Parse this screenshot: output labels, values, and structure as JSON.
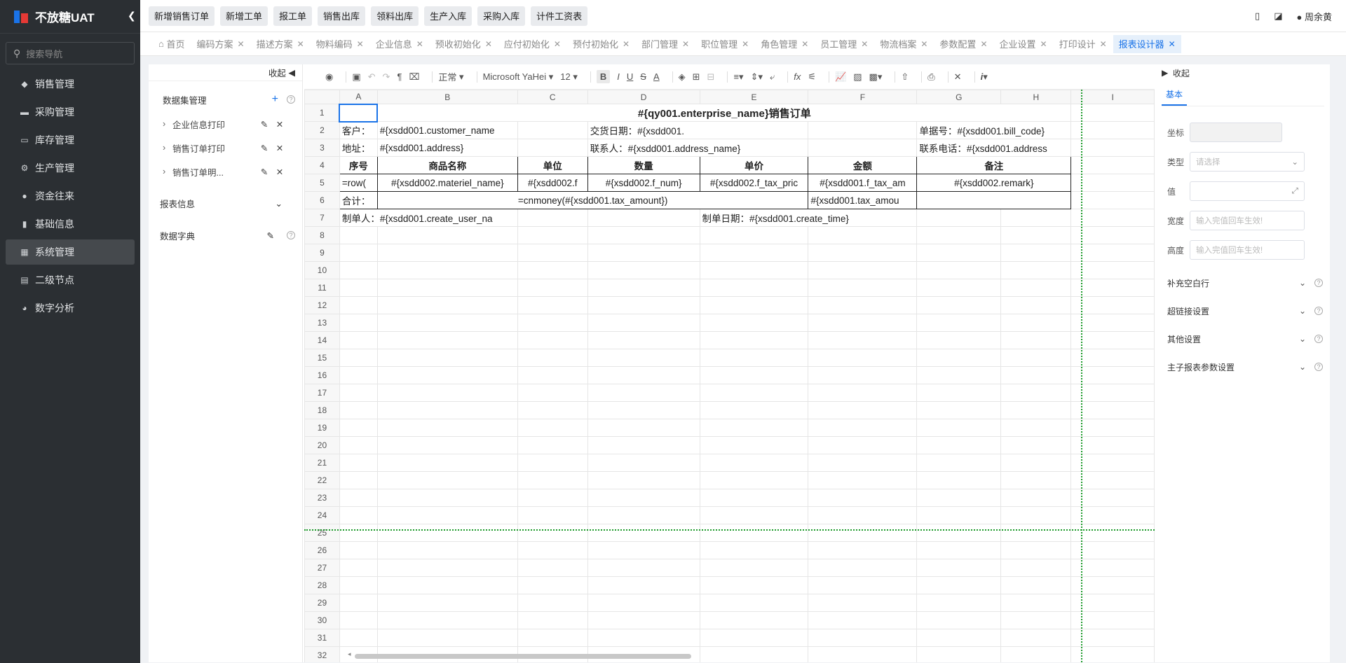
{
  "app": {
    "title": "不放糖UAT"
  },
  "search": {
    "placeholder": "搜索导航"
  },
  "sidebar": {
    "items": [
      {
        "label": "销售管理",
        "icon": "tag-icon"
      },
      {
        "label": "采购管理",
        "icon": "cart-icon"
      },
      {
        "label": "库存管理",
        "icon": "warehouse-icon"
      },
      {
        "label": "生产管理",
        "icon": "production-icon"
      },
      {
        "label": "资金往来",
        "icon": "money-icon"
      },
      {
        "label": "基础信息",
        "icon": "base-info-icon"
      },
      {
        "label": "系统管理",
        "icon": "system-icon",
        "active": true
      },
      {
        "label": "二级节点",
        "icon": "node-icon"
      },
      {
        "label": "数字分析",
        "icon": "pie-chart-icon"
      }
    ]
  },
  "quick_buttons": [
    "新增销售订单",
    "新增工单",
    "报工单",
    "销售出库",
    "领料出库",
    "生产入库",
    "采购入库",
    "计件工资表"
  ],
  "user": {
    "name": "周余黄"
  },
  "tabs": [
    {
      "label": "首页",
      "home": true
    },
    {
      "label": "编码方案"
    },
    {
      "label": "描述方案"
    },
    {
      "label": "物料编码"
    },
    {
      "label": "企业信息"
    },
    {
      "label": "预收初始化"
    },
    {
      "label": "应付初始化"
    },
    {
      "label": "预付初始化"
    },
    {
      "label": "部门管理"
    },
    {
      "label": "职位管理"
    },
    {
      "label": "角色管理"
    },
    {
      "label": "员工管理"
    },
    {
      "label": "物流档案"
    },
    {
      "label": "参数配置"
    },
    {
      "label": "企业设置"
    },
    {
      "label": "打印设计"
    },
    {
      "label": "报表设计器",
      "active": true
    }
  ],
  "left_panel": {
    "collapse": "收起",
    "dataset_title": "数据集管理",
    "datasets": [
      "企业信息打印",
      "销售订单打印",
      "销售订单明..."
    ],
    "report_info": "报表信息",
    "dictionary": "数据字典"
  },
  "toolbar": {
    "style": "正常",
    "font": "Microsoft YaHei",
    "size": "12"
  },
  "sheet": {
    "columns": [
      "A",
      "B",
      "C",
      "D",
      "E",
      "F",
      "G",
      "H",
      "I"
    ],
    "title": "#{qy001.enterprise_name}销售订单",
    "r2": {
      "a": "客户：",
      "b": "#{xsdd001.customer_name",
      "d": "交货日期：#{xsdd001.",
      "g": "单据号：#{xsdd001.bill_code}"
    },
    "r3": {
      "a": "地址：",
      "b": "#{xsdd001.address}",
      "d": "联系人：#{xsdd001.address_name}",
      "g": "联系电话：#{xsdd001.address"
    },
    "r4": [
      "序号",
      "商品名称",
      "单位",
      "数量",
      "单价",
      "金额",
      "备注"
    ],
    "r5": [
      "=row(",
      "#{xsdd002.materiel_name}",
      "#{xsdd002.f",
      "#{xsdd002.f_num}",
      "#{xsdd002.f_tax_pric",
      "#{xsdd001.f_tax_am",
      "#{xsdd002.remark}"
    ],
    "r6": {
      "a": "合计：",
      "b": "=cnmoney(#{xsdd001.tax_amount})",
      "f": "#{xsdd001.tax_amou"
    },
    "r7": {
      "a": "制单人：#{xsdd001.create_user_na",
      "e": "制单日期：#{xsdd001.create_time}"
    }
  },
  "right_panel": {
    "collapse": "收起",
    "tab": "基本",
    "coord_label": "坐标",
    "type_label": "类型",
    "type_placeholder": "请选择",
    "value_label": "值",
    "width_label": "宽度",
    "width_placeholder": "输入完值回车生效!",
    "height_label": "高度",
    "height_placeholder": "输入完值回车生效!",
    "sections": [
      "补充空白行",
      "超链接设置",
      "其他设置",
      "主子报表参数设置"
    ]
  }
}
